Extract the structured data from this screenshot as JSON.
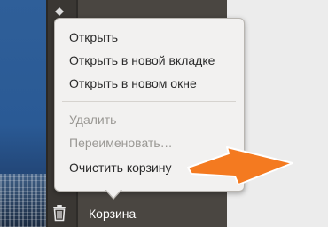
{
  "sidebar": {
    "top_item_label": "",
    "trash_label": "Корзина"
  },
  "menu": {
    "items": [
      {
        "label": "Открыть",
        "enabled": true
      },
      {
        "label": "Открыть в новой вкладке",
        "enabled": true
      },
      {
        "label": "Открыть в новом окне",
        "enabled": true
      },
      {
        "label": "Удалить",
        "enabled": false
      },
      {
        "label": "Переименовать…",
        "enabled": false
      },
      {
        "label": "Очистить корзину",
        "enabled": true
      }
    ]
  },
  "colors": {
    "arrow": "#f47a20",
    "menu_bg": "#f2f1f0",
    "disabled_text": "#9a9894"
  },
  "icons": [
    "trash-icon",
    "arrow-pointer"
  ]
}
